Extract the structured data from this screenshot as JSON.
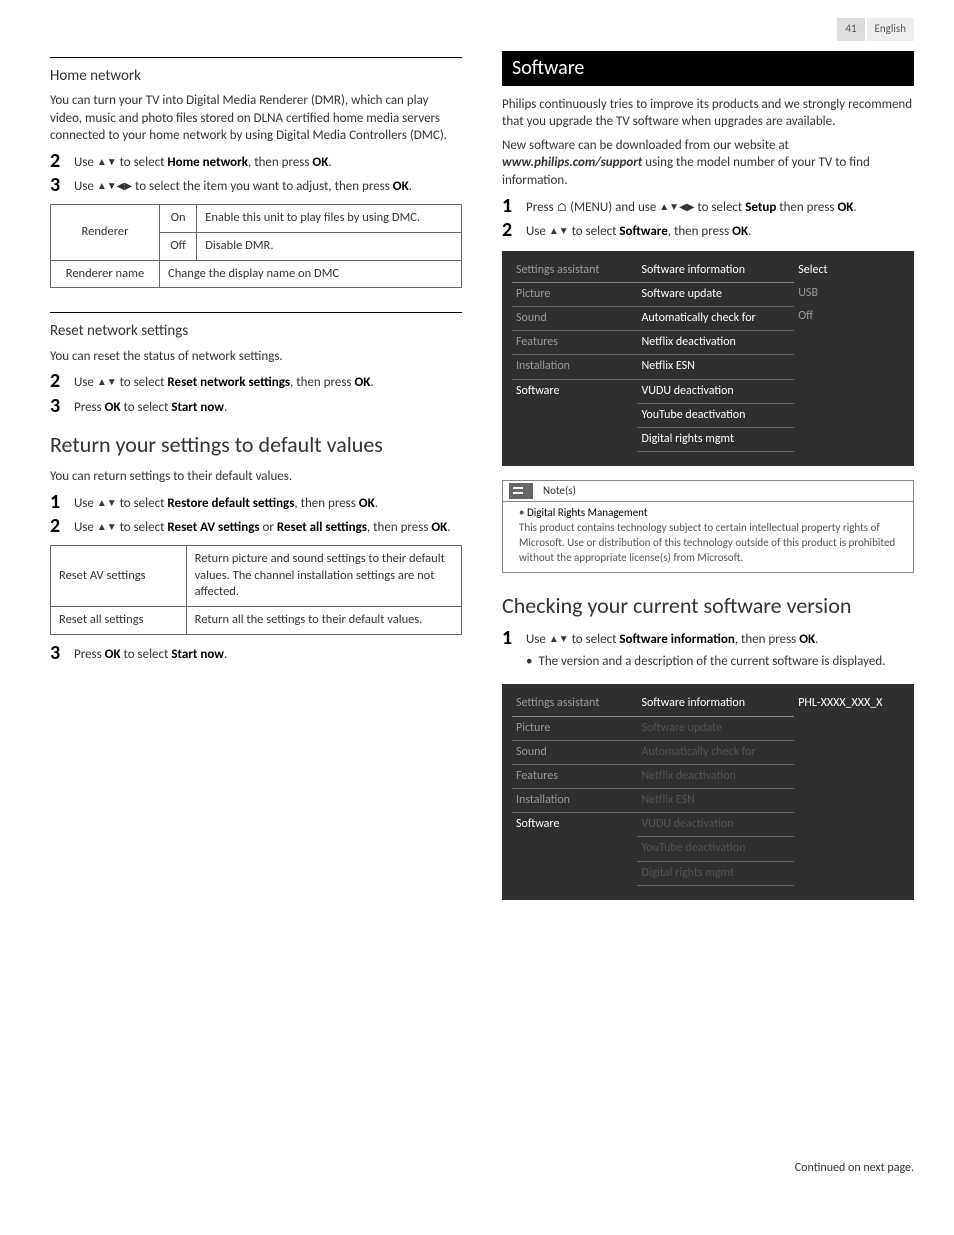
{
  "header": {
    "page": "41",
    "lang": "English"
  },
  "left": {
    "home_net": {
      "title": "Home network",
      "intro": "You can turn your TV into Digital Media Renderer (DMR), which can play video, music and photo files stored on DLNA certified home media servers connected to your home network by using Digital Media Controllers (DMC).",
      "step2": {
        "n": "2",
        "pre": "Use ",
        "mid": " to select ",
        "bold1": "Home network",
        "post": ", then press ",
        "bold2": "OK",
        "end": "."
      },
      "step3": {
        "n": "3",
        "pre": "Use ",
        "mid": " to select the item you want to adjust, then press ",
        "bold": "OK",
        "end": "."
      },
      "table": {
        "r1c1": "Renderer",
        "r1c2": "On",
        "r1c3": "Enable this unit to play files by using DMC.",
        "r2c2": "Off",
        "r2c3": "Disable DMR.",
        "r3c1": "Renderer name",
        "r3c3": "Change the display name on DMC"
      }
    },
    "reset_net": {
      "title": "Reset network settings",
      "intro": "You can reset the status of network settings.",
      "step2": {
        "n": "2",
        "pre": "Use ",
        "mid": " to select ",
        "bold1": "Reset network settings",
        "post": ", then press ",
        "bold2": "OK",
        "end": "."
      },
      "step3": {
        "n": "3",
        "pre": "Press ",
        "bold1": "OK",
        "mid": " to select ",
        "bold2": "Start now",
        "end": "."
      }
    },
    "return_def": {
      "title": "Return your settings to default values",
      "intro": "You can return settings to their default values.",
      "step1": {
        "n": "1",
        "pre": "Use ",
        "mid": " to select ",
        "bold1": "Restore default settings",
        "post": ", then press ",
        "bold2": "OK",
        "end": "."
      },
      "step2": {
        "n": "2",
        "pre": "Use ",
        "mid": " to select ",
        "bold1": "Reset AV settings",
        "or": " or ",
        "bold2": "Reset all settings",
        "post": ", then press ",
        "bold3": "OK",
        "end": "."
      },
      "table": {
        "r1c1": "Reset AV settings",
        "r1c2": "Return picture and sound settings to their default values. The channel installation settings are not affected.",
        "r2c1": "Reset all settings",
        "r2c2": "Return all the settings to their default values."
      },
      "step3": {
        "n": "3",
        "pre": "Press ",
        "bold1": "OK",
        "mid": " to select ",
        "bold2": "Start now",
        "end": "."
      }
    }
  },
  "right": {
    "software": {
      "title": "Software",
      "intro": "Philips continuously tries to improve its products and we strongly recommend that you upgrade the TV software when upgrades are available.",
      "dl_pre": "New software can be downloaded from our website at ",
      "dl_url": "www.philips.com/support",
      "dl_post": " using the model number of your TV to find information.",
      "step1": {
        "n": "1",
        "pre": "Press ",
        "menu": " (MENU) and use ",
        "mid": " to select ",
        "bold1": "Setup",
        "post": " then press ",
        "bold2": "OK",
        "end": "."
      },
      "step2": {
        "n": "2",
        "pre": "Use ",
        "mid": " to select ",
        "bold1": "Software",
        "post": ", then press ",
        "bold2": "OK",
        "end": "."
      },
      "tv1": {
        "left": [
          "Settings assistant",
          "Picture",
          "Sound",
          "Features",
          "Installation",
          "Software"
        ],
        "mid": [
          "Software information",
          "Software update",
          "Automatically check for",
          "Netflix deactivation",
          "Netflix ESN",
          "VUDU deactivation",
          "YouTube deactivation",
          "Digital rights mgmt"
        ],
        "right": [
          "Select",
          "USB",
          "Off"
        ]
      },
      "note_label": "Note(s)",
      "note_title": "Digital Rights Management",
      "note_body": "This product contains technology subject to certain intellectual property rights of Microsoft. Use or distribution of this technology outside of this product is prohibited without the appropriate license(s) from Microsoft."
    },
    "check_ver": {
      "title": "Checking your current software version",
      "step1": {
        "n": "1",
        "pre": "Use ",
        "mid": " to select ",
        "bold1": "Software information",
        "post": ", then press ",
        "bold2": "OK",
        "end": "."
      },
      "bullet": "The version and a description of the current software is displayed.",
      "tv2": {
        "left": [
          "Settings assistant",
          "Picture",
          "Sound",
          "Features",
          "Installation",
          "Software"
        ],
        "mid": [
          "Software information",
          "Software update",
          "Automatically check for",
          "Netflix deactivation",
          "Netflix ESN",
          "VUDU deactivation",
          "YouTube deactivation",
          "Digital rights mgmt"
        ],
        "right": "PHL-XXXX_XXX_X"
      }
    }
  },
  "footer": "Continued on next page."
}
